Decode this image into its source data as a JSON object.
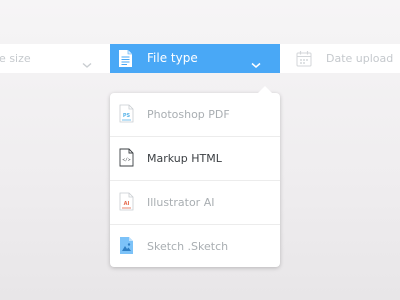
{
  "filters": {
    "size": {
      "label": "le size",
      "icon": "chevron-down-icon"
    },
    "type": {
      "label": "File type",
      "icon": "document-icon",
      "accent": "#49a8f6"
    },
    "date": {
      "label": "Date upload",
      "icon": "calendar-icon"
    }
  },
  "menu": {
    "items": [
      {
        "label": "Photoshop PDF",
        "badge": "PS",
        "icon": "photoshop-file-icon",
        "color": "#5ab4e8"
      },
      {
        "label": "Markup HTML",
        "badge": "</>",
        "icon": "html-file-icon",
        "color": "#3b3f43",
        "selected": true
      },
      {
        "label": "Illustrator AI",
        "badge": "AI",
        "icon": "illustrator-file-icon",
        "color": "#e46a4c"
      },
      {
        "label": "Sketch .Sketch",
        "badge": "",
        "icon": "sketch-file-icon",
        "color": "#49a8f6"
      }
    ]
  }
}
